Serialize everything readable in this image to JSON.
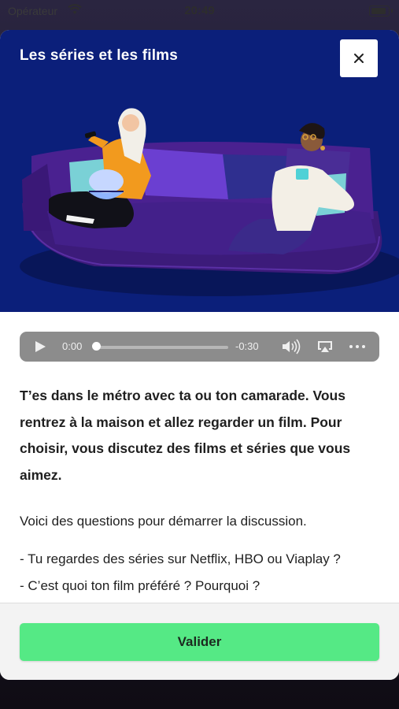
{
  "status_bar": {
    "carrier": "Opérateur",
    "time": "20:49"
  },
  "modal": {
    "title": "Les séries et les films",
    "close_icon": "close-icon"
  },
  "audio_player": {
    "current_time": "0:00",
    "remaining_time": "-0:30",
    "progress": 0
  },
  "content": {
    "intro": "T’es dans le métro avec ta ou ton camarade. Vous rentrez à la maison et allez regarder un film. Pour choisir, vous discutez des films et séries que vous aimez.",
    "prompt": "Voici des questions pour démarrer la discussion.",
    "questions": [
      "- Tu regardes des séries sur Netflix, HBO ou Viaplay ?",
      "- C’est quoi ton film préféré ? Pourquoi ?"
    ]
  },
  "footer": {
    "validate_label": "Valider"
  },
  "colors": {
    "hero_background": "#0b1f7a",
    "validate_button": "#55e985"
  }
}
